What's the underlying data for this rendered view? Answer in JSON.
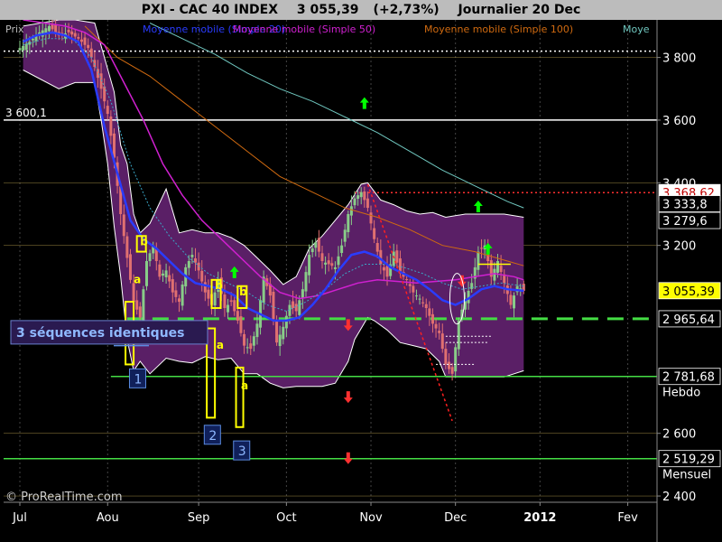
{
  "header": {
    "symbol": "PXI - CAC 40 INDEX",
    "price": "3 055,39",
    "change": "(+2,73%)",
    "period": "Journalier  20 Dec"
  },
  "colors": {
    "background": "#000000",
    "band_fill": "#5a1f66",
    "band_edge": "#ffffff",
    "ma_fast": "#2a3cff",
    "ma_20": "#3aa8c8",
    "ma_50": "#d020d0",
    "ma_100": "#d06a10",
    "ma_200": "#70c8c0",
    "support": "#44dd44",
    "candle_up": "#88cc88",
    "candle_down": "#e07070"
  },
  "legend": {
    "prix": "Prix",
    "ma_20": "Moyenne mobile (Simple 20)",
    "ma_50": "Moyenne mobile (Simple 50)",
    "ma_100": "Moyenne mobile (Simple 100)",
    "ma_200": "Moye"
  },
  "chart_data": {
    "type": "candlestick",
    "ylim": [
      2380,
      3920
    ],
    "y_ticks": [
      2400,
      2600,
      3200,
      3400,
      3600,
      3800
    ],
    "y_tick_labels": [
      "2 400",
      "2 600",
      "3 200",
      "3 400",
      "3 600",
      "3 800"
    ],
    "x_ticks": [
      {
        "label": "Jul",
        "day": 0
      },
      {
        "label": "Aou",
        "day": 27
      },
      {
        "label": "Sep",
        "day": 55
      },
      {
        "label": "Oct",
        "day": 82
      },
      {
        "label": "Nov",
        "day": 108
      },
      {
        "label": "Dec",
        "day": 134
      },
      {
        "label": "2012",
        "day": 160
      },
      {
        "label": "Fev",
        "day": 187
      }
    ],
    "x_range": [
      -5,
      196
    ],
    "close_points": [
      [
        0,
        3830
      ],
      [
        3,
        3850
      ],
      [
        6,
        3880
      ],
      [
        9,
        3900
      ],
      [
        12,
        3870
      ],
      [
        15,
        3880
      ],
      [
        18,
        3860
      ],
      [
        21,
        3830
      ],
      [
        23,
        3770
      ],
      [
        25,
        3700
      ],
      [
        27,
        3620
      ],
      [
        29,
        3480
      ],
      [
        31,
        3300
      ],
      [
        33,
        3160
      ],
      [
        35,
        3020
      ],
      [
        37,
        2970
      ],
      [
        39,
        3150
      ],
      [
        41,
        3200
      ],
      [
        43,
        3100
      ],
      [
        45,
        3120
      ],
      [
        47,
        3050
      ],
      [
        49,
        3020
      ],
      [
        51,
        3130
      ],
      [
        53,
        3170
      ],
      [
        55,
        3120
      ],
      [
        57,
        3050
      ],
      [
        59,
        3010
      ],
      [
        61,
        3090
      ],
      [
        63,
        3000
      ],
      [
        65,
        3020
      ],
      [
        67,
        2960
      ],
      [
        69,
        2880
      ],
      [
        71,
        2870
      ],
      [
        73,
        2950
      ],
      [
        75,
        3100
      ],
      [
        77,
        3040
      ],
      [
        79,
        2890
      ],
      [
        81,
        2940
      ],
      [
        83,
        3010
      ],
      [
        85,
        2990
      ],
      [
        87,
        3060
      ],
      [
        89,
        3170
      ],
      [
        91,
        3210
      ],
      [
        93,
        3150
      ],
      [
        95,
        3140
      ],
      [
        97,
        3130
      ],
      [
        99,
        3200
      ],
      [
        101,
        3300
      ],
      [
        103,
        3350
      ],
      [
        105,
        3370
      ],
      [
        107,
        3320
      ],
      [
        109,
        3220
      ],
      [
        111,
        3140
      ],
      [
        113,
        3100
      ],
      [
        115,
        3180
      ],
      [
        117,
        3110
      ],
      [
        119,
        3090
      ],
      [
        121,
        3050
      ],
      [
        123,
        3030
      ],
      [
        125,
        3000
      ],
      [
        127,
        2950
      ],
      [
        129,
        2920
      ],
      [
        131,
        2820
      ],
      [
        133,
        2790
      ],
      [
        135,
        2960
      ],
      [
        137,
        3030
      ],
      [
        139,
        3080
      ],
      [
        141,
        3180
      ],
      [
        143,
        3200
      ],
      [
        145,
        3100
      ],
      [
        147,
        3150
      ],
      [
        149,
        3080
      ],
      [
        151,
        3010
      ],
      [
        153,
        3070
      ],
      [
        155,
        3055
      ]
    ],
    "band_upper": [
      [
        1,
        3900
      ],
      [
        12,
        3920
      ],
      [
        17,
        3920
      ],
      [
        23,
        3910
      ],
      [
        29,
        3690
      ],
      [
        31,
        3520
      ],
      [
        33,
        3460
      ],
      [
        35,
        3300
      ],
      [
        37,
        3240
      ],
      [
        40,
        3270
      ],
      [
        45,
        3380
      ],
      [
        49,
        3240
      ],
      [
        53,
        3250
      ],
      [
        57,
        3240
      ],
      [
        61,
        3240
      ],
      [
        65,
        3225
      ],
      [
        69,
        3200
      ],
      [
        73,
        3160
      ],
      [
        77,
        3120
      ],
      [
        81,
        3075
      ],
      [
        85,
        3100
      ],
      [
        89,
        3190
      ],
      [
        93,
        3230
      ],
      [
        97,
        3280
      ],
      [
        101,
        3330
      ],
      [
        105,
        3395
      ],
      [
        107,
        3400
      ],
      [
        111,
        3345
      ],
      [
        115,
        3330
      ],
      [
        119,
        3310
      ],
      [
        123,
        3300
      ],
      [
        127,
        3305
      ],
      [
        131,
        3290
      ],
      [
        137,
        3300
      ],
      [
        143,
        3300
      ],
      [
        149,
        3300
      ],
      [
        155,
        3290
      ]
    ],
    "band_lower": [
      [
        1,
        3760
      ],
      [
        12,
        3700
      ],
      [
        17,
        3720
      ],
      [
        23,
        3720
      ],
      [
        25,
        3600
      ],
      [
        27,
        3460
      ],
      [
        29,
        3260
      ],
      [
        31,
        3100
      ],
      [
        33,
        2900
      ],
      [
        35,
        2800
      ],
      [
        37,
        2830
      ],
      [
        40,
        2790
      ],
      [
        45,
        2840
      ],
      [
        49,
        2830
      ],
      [
        53,
        2825
      ],
      [
        57,
        2845
      ],
      [
        61,
        2835
      ],
      [
        65,
        2840
      ],
      [
        69,
        2790
      ],
      [
        73,
        2790
      ],
      [
        77,
        2760
      ],
      [
        81,
        2745
      ],
      [
        85,
        2750
      ],
      [
        89,
        2750
      ],
      [
        93,
        2750
      ],
      [
        97,
        2760
      ],
      [
        101,
        2830
      ],
      [
        103,
        2900
      ],
      [
        107,
        2970
      ],
      [
        109,
        2960
      ],
      [
        113,
        2930
      ],
      [
        117,
        2890
      ],
      [
        121,
        2880
      ],
      [
        125,
        2870
      ],
      [
        129,
        2830
      ],
      [
        131,
        2780
      ],
      [
        137,
        2780
      ],
      [
        143,
        2780
      ],
      [
        149,
        2780
      ],
      [
        155,
        2800
      ]
    ],
    "ma_fast": [
      [
        1,
        3850
      ],
      [
        5,
        3870
      ],
      [
        10,
        3880
      ],
      [
        14,
        3870
      ],
      [
        18,
        3850
      ],
      [
        22,
        3760
      ],
      [
        26,
        3580
      ],
      [
        30,
        3430
      ],
      [
        34,
        3280
      ],
      [
        38,
        3220
      ],
      [
        42,
        3190
      ],
      [
        46,
        3150
      ],
      [
        50,
        3110
      ],
      [
        54,
        3080
      ],
      [
        58,
        3070
      ],
      [
        62,
        3060
      ],
      [
        66,
        3040
      ],
      [
        70,
        3000
      ],
      [
        74,
        2980
      ],
      [
        78,
        2960
      ],
      [
        82,
        2960
      ],
      [
        86,
        2970
      ],
      [
        90,
        3010
      ],
      [
        94,
        3060
      ],
      [
        98,
        3120
      ],
      [
        102,
        3170
      ],
      [
        106,
        3180
      ],
      [
        110,
        3165
      ],
      [
        114,
        3130
      ],
      [
        118,
        3110
      ],
      [
        122,
        3090
      ],
      [
        126,
        3060
      ],
      [
        130,
        3025
      ],
      [
        134,
        3010
      ],
      [
        138,
        3030
      ],
      [
        142,
        3060
      ],
      [
        146,
        3070
      ],
      [
        150,
        3060
      ],
      [
        155,
        3055
      ]
    ],
    "ma_20": [
      [
        1,
        3840
      ],
      [
        8,
        3860
      ],
      [
        16,
        3860
      ],
      [
        22,
        3800
      ],
      [
        28,
        3660
      ],
      [
        34,
        3460
      ],
      [
        40,
        3320
      ],
      [
        46,
        3230
      ],
      [
        52,
        3160
      ],
      [
        58,
        3110
      ],
      [
        64,
        3080
      ],
      [
        70,
        3050
      ],
      [
        76,
        3010
      ],
      [
        82,
        2990
      ],
      [
        88,
        3020
      ],
      [
        94,
        3060
      ],
      [
        100,
        3110
      ],
      [
        106,
        3140
      ],
      [
        112,
        3140
      ],
      [
        118,
        3130
      ],
      [
        124,
        3110
      ],
      [
        130,
        3080
      ],
      [
        136,
        3060
      ],
      [
        142,
        3070
      ],
      [
        148,
        3080
      ],
      [
        155,
        3070
      ]
    ],
    "ma_50": [
      [
        1,
        3920
      ],
      [
        14,
        3900
      ],
      [
        20,
        3880
      ],
      [
        26,
        3840
      ],
      [
        32,
        3720
      ],
      [
        38,
        3600
      ],
      [
        44,
        3460
      ],
      [
        50,
        3360
      ],
      [
        56,
        3280
      ],
      [
        62,
        3220
      ],
      [
        68,
        3160
      ],
      [
        74,
        3100
      ],
      [
        80,
        3050
      ],
      [
        86,
        3030
      ],
      [
        92,
        3040
      ],
      [
        98,
        3060
      ],
      [
        104,
        3080
      ],
      [
        110,
        3090
      ],
      [
        116,
        3085
      ],
      [
        122,
        3080
      ],
      [
        128,
        3085
      ],
      [
        134,
        3090
      ],
      [
        140,
        3100
      ],
      [
        146,
        3110
      ],
      [
        152,
        3100
      ],
      [
        155,
        3090
      ]
    ],
    "ma_100": [
      [
        20,
        3900
      ],
      [
        30,
        3800
      ],
      [
        40,
        3740
      ],
      [
        50,
        3660
      ],
      [
        60,
        3580
      ],
      [
        70,
        3500
      ],
      [
        80,
        3420
      ],
      [
        90,
        3370
      ],
      [
        100,
        3320
      ],
      [
        110,
        3290
      ],
      [
        120,
        3250
      ],
      [
        130,
        3200
      ],
      [
        140,
        3180
      ],
      [
        150,
        3150
      ],
      [
        155,
        3135
      ]
    ],
    "ma_200": [
      [
        40,
        3910
      ],
      [
        50,
        3860
      ],
      [
        60,
        3810
      ],
      [
        70,
        3750
      ],
      [
        80,
        3700
      ],
      [
        90,
        3660
      ],
      [
        100,
        3610
      ],
      [
        110,
        3560
      ],
      [
        120,
        3500
      ],
      [
        130,
        3440
      ],
      [
        140,
        3390
      ],
      [
        150,
        3340
      ],
      [
        155,
        3320
      ]
    ],
    "horizontal_levels": [
      {
        "name": "level-3600-1",
        "value": 3600.1,
        "color": "#ffffff",
        "style": "solid",
        "label": "3 600,1",
        "box": ""
      },
      {
        "name": "level-3800-dotted",
        "value": 3820,
        "color": "#ffffff",
        "style": "dotted",
        "label": "",
        "box": ""
      },
      {
        "name": "level-3368-62",
        "value": 3368.62,
        "color": "#ff3030",
        "style": "dotted",
        "label": "",
        "box": "3 368,62"
      },
      {
        "name": "level-2965-64",
        "value": 2965.64,
        "color": "#44dd44",
        "style": "dashed",
        "label": "",
        "box": "2 965,64"
      },
      {
        "name": "level-2781-68",
        "value": 2781.68,
        "color": "#44dd44",
        "style": "solid",
        "label": "",
        "box": "2 781,68"
      },
      {
        "name": "level-2519-29",
        "value": 2519.29,
        "color": "#44dd44",
        "style": "solid",
        "label": "",
        "box": "2 519,29"
      }
    ],
    "price_boxes": [
      {
        "value": 3368.62,
        "label": "3 368,62",
        "bg": "#ffffff",
        "fg": "#c00000"
      },
      {
        "value": 3333,
        "label": "3 333,8",
        "bg": "#000000",
        "fg": "#ffffff"
      },
      {
        "value": 3279.6,
        "label": "3 279,6",
        "bg": "#000000",
        "fg": "#ffffff"
      },
      {
        "value": 3055.39,
        "label": "3 055,39",
        "bg": "#ffff00",
        "fg": "#000000"
      },
      {
        "value": 2965.64,
        "label": "2 965,64",
        "bg": "#000000",
        "fg": "#ffffff"
      },
      {
        "value": 2781.68,
        "label": "2 781,68",
        "bg": "#000000",
        "fg": "#ffffff"
      },
      {
        "value": 2519.29,
        "label": "2 519,29",
        "bg": "#000000",
        "fg": "#ffffff"
      }
    ],
    "level_tags": {
      "hebdo": "Hebdo",
      "mensuel": "Mensuel"
    },
    "annotation_text": "3 séquences identiques",
    "sequence_labels": [
      "1",
      "2",
      "3"
    ],
    "pattern_labels": [
      "b",
      "a"
    ],
    "watermark": "© ProRealTime.com",
    "trendline": [
      [
        107,
        3395
      ],
      [
        133,
        2640
      ]
    ],
    "arrows": [
      {
        "day": 106,
        "price": 3650,
        "dir": "up",
        "color": "#00ff00"
      },
      {
        "day": 141,
        "price": 3320,
        "dir": "up",
        "color": "#00ff00"
      },
      {
        "day": 66,
        "price": 3110,
        "dir": "up",
        "color": "#00ff00"
      },
      {
        "day": 144,
        "price": 3185,
        "dir": "up",
        "color": "#00ff00"
      },
      {
        "day": 101,
        "price": 2950,
        "dir": "down",
        "color": "#ff3030"
      },
      {
        "day": 101,
        "price": 2720,
        "dir": "down",
        "color": "#ff3030"
      },
      {
        "day": 101,
        "price": 2525,
        "dir": "down",
        "color": "#ff3030"
      },
      {
        "day": 136,
        "price": 3090,
        "dir": "down",
        "color": "#ff3030"
      }
    ]
  }
}
